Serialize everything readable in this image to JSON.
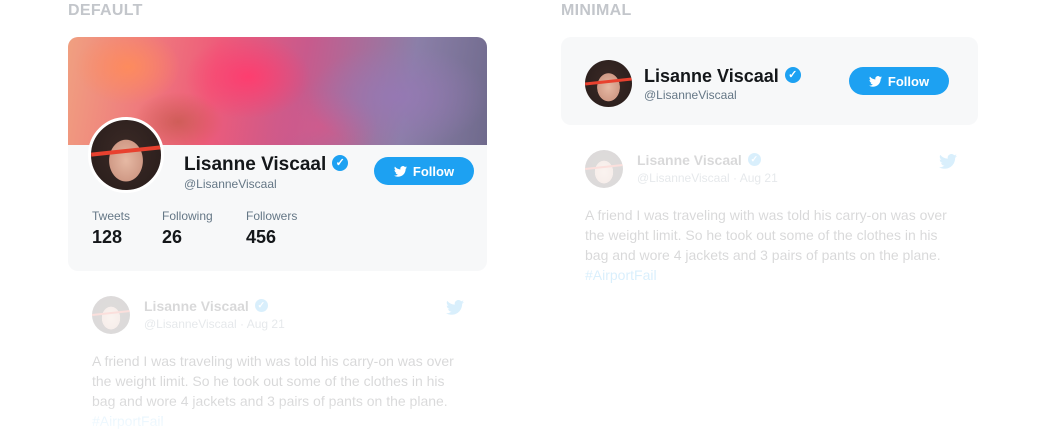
{
  "labels": {
    "default": "DEFAULT",
    "minimal": "MINIMAL"
  },
  "profile": {
    "name": "Lisanne Viscaal",
    "handle": "@LisanneViscaal",
    "follow_label": "Follow",
    "verified_icon": "verified-badge-icon"
  },
  "stats": [
    {
      "label": "Tweets",
      "value": "128"
    },
    {
      "label": "Following",
      "value": "26"
    },
    {
      "label": "Followers",
      "value": "456"
    }
  ],
  "tweet": {
    "name": "Lisanne Viscaal",
    "handle": "@LisanneViscaal",
    "separator": "·",
    "date": "Aug 21",
    "text": "A friend I was traveling with was told his carry-on was over the weight limit. So he took out some of the clothes in his bag and wore 4 jackets and 3 pairs of pants on the plane.",
    "hashtag": "#AirportFail"
  },
  "colors": {
    "twitter_blue": "#1da1f2",
    "label_gray": "#c3c6cb",
    "card_bg": "#f7f8f9",
    "text_dark": "#14171a",
    "text_muted": "#657786"
  }
}
